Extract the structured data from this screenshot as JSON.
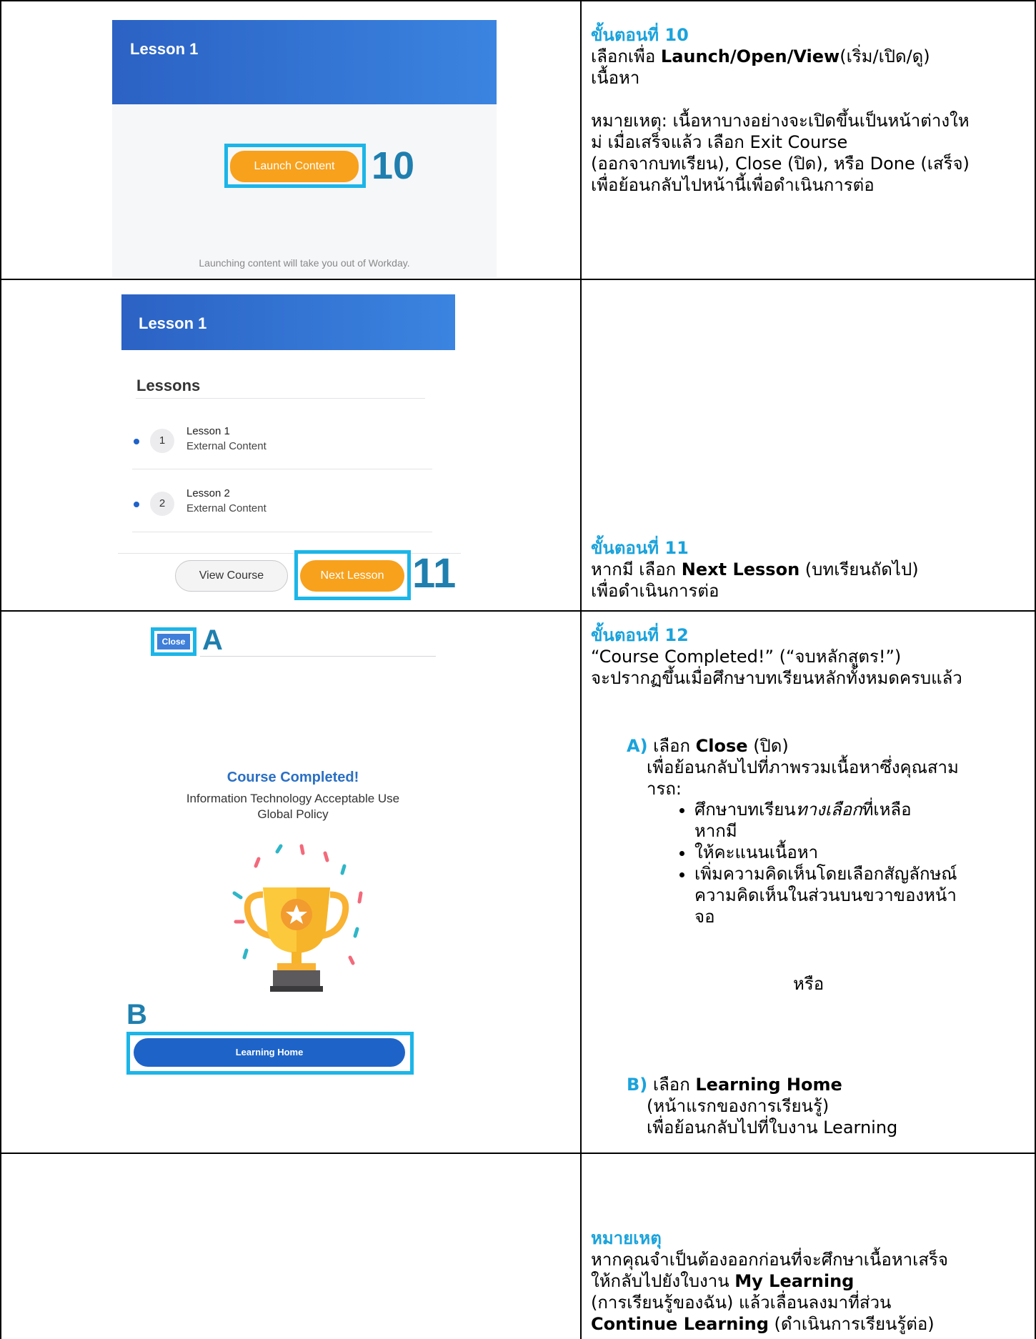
{
  "step10": {
    "title": "ขั้นตอนที่ 10",
    "line1_pre": "เลือกเพื่อ ",
    "line1_bold": "Launch/Open/View",
    "line1_post": "(เริ่ม/เปิด/ดู)",
    "line2": "เนื้อหา",
    "note_lines": [
      "หมายเหตุ: เนื้อหาบางอย่างจะเปิดขึ้นเป็นหน้าต่างให",
      "ม่ เมื่อเสร็จแล้ว เลือก Exit Course",
      "(ออกจากบทเรียน), Close (ปิด), หรือ Done (เสร็จ)",
      "เพื่อย้อนกลับไปหน้านี้เพื่อดำเนินการต่อ"
    ],
    "screenshot": {
      "header": "Lesson 1",
      "button": "Launch Content",
      "marker": "10",
      "footer": "Launching content will take you out of Workday."
    }
  },
  "step11": {
    "title": "ขั้นตอนที่ 11",
    "line1_pre": "หากมี เลือก ",
    "line1_bold": "Next Lesson",
    "line1_post": " (บทเรียนถัดไป)",
    "line2": "เพื่อดำเนินการต่อ",
    "screenshot": {
      "header": "Lesson 1",
      "section": "Lessons",
      "lessons": [
        {
          "num": "1",
          "title": "Lesson 1",
          "sub": "External Content"
        },
        {
          "num": "2",
          "title": "Lesson 2",
          "sub": "External Content"
        }
      ],
      "view_course": "View Course",
      "next_lesson": "Next Lesson",
      "marker": "11"
    }
  },
  "step12": {
    "title": "ขั้นตอนที่ 12",
    "line1": "“Course Completed!” (“จบหลักสูตร!”)",
    "line2": "จะปรากฏขึ้นเมื่อศึกษาบทเรียนหลักทั้งหมดครบแล้ว",
    "a_label": "A)",
    "a_pre": " เลือก ",
    "a_bold": "Close",
    "a_post": " (ปิด)",
    "a_desc1": "เพื่อย้อนกลับไปที่ภาพรวมเนื้อหาซึ่งคุณสาม",
    "a_desc2": "ารถ:",
    "bullet1_pre": "ศึกษาบทเรียน",
    "bullet1_italic": "ทางเลือก",
    "bullet1_post": "ที่เหลือ",
    "bullet1_line2": "หากมี",
    "bullet2": "ให้คะแนนเนื้อหา",
    "bullet3_l1": "เพิ่มความคิดเห็นโดยเลือกสัญลักษณ์",
    "bullet3_l2": "ความคิดเห็นในส่วนบนขวาของหน้า",
    "bullet3_l3": "จอ",
    "or": "หรือ",
    "b_label": "B)",
    "b_pre": " เลือก ",
    "b_bold": "Learning Home",
    "b_line2": "(หน้าแรกของการเรียนรู้)",
    "b_line3": "เพื่อย้อนกลับไปที่ใบงาน Learning",
    "screenshot": {
      "close": "Close",
      "marker_a": "A",
      "completed": "Course Completed!",
      "course_l1": "Information Technology Acceptable Use",
      "course_l2": "Global Policy",
      "marker_b": "B",
      "learning_home": "Learning Home"
    }
  },
  "note": {
    "title": "หมายเหตุ",
    "l1": "หากคุณจำเป็นต้องออกก่อนที่จะศึกษาเนื้อหาเสร็จ",
    "l2_pre": "ให้กลับไปยังใบงาน ",
    "l2_bold": "My Learning",
    "l3": "(การเรียนรู้ของฉัน) แล้วเลื่อนลงมาที่ส่วน",
    "l4_bold": "Continue Learning",
    "l4_post": " (ดำเนินการเรียนรู้ต่อ)"
  },
  "colors": {
    "accent": "#1aa3dc",
    "highlight": "#1cb5e8",
    "orange": "#f7a11d",
    "blue_header": "#2b62c4"
  }
}
